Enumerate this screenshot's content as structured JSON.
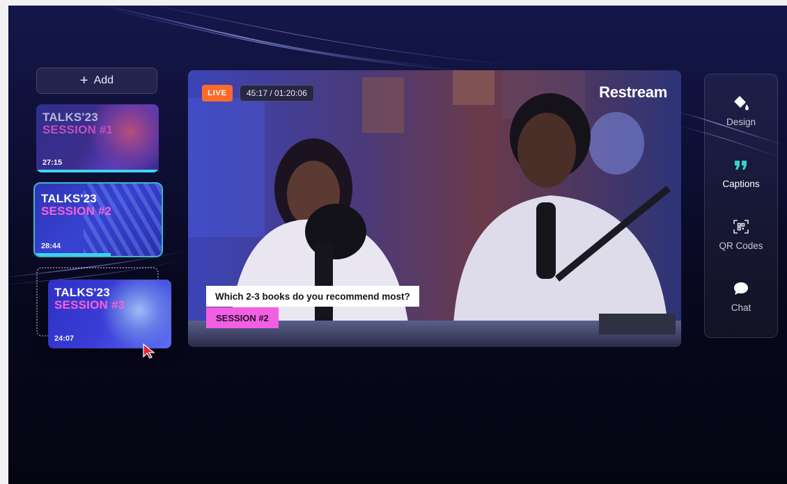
{
  "sidebar": {
    "add_label": "Add",
    "add_icon": "plus-icon",
    "sessions": [
      {
        "line1": "TALKS'23",
        "line2": "SESSION #1",
        "duration": "27:15",
        "progress": 1.0
      },
      {
        "line1": "TALKS'23",
        "line2": "SESSION #2",
        "duration": "28:44",
        "progress": 0.6
      },
      {
        "line1": "TALKS'23",
        "line2": "SESSION #3",
        "duration": "24:07",
        "progress": 0.0
      }
    ]
  },
  "video": {
    "live_label": "LIVE",
    "time": "45:17 / 01:20:06",
    "brand": "Restream",
    "caption": "Which 2-3 books do you recommend most?",
    "session_tag": "SESSION #2"
  },
  "toolbar": {
    "items": [
      {
        "label": "Design",
        "icon": "paint-bucket-icon"
      },
      {
        "label": "Captions",
        "icon": "quote-icon"
      },
      {
        "label": "QR Codes",
        "icon": "qr-scan-icon"
      },
      {
        "label": "Chat",
        "icon": "chat-bubble-icon"
      }
    ]
  },
  "colors": {
    "live": "#ff6a2b",
    "accent_pink": "#f35fe3",
    "progress": "#3ad6f0",
    "captions_icon": "#35d4c7"
  }
}
